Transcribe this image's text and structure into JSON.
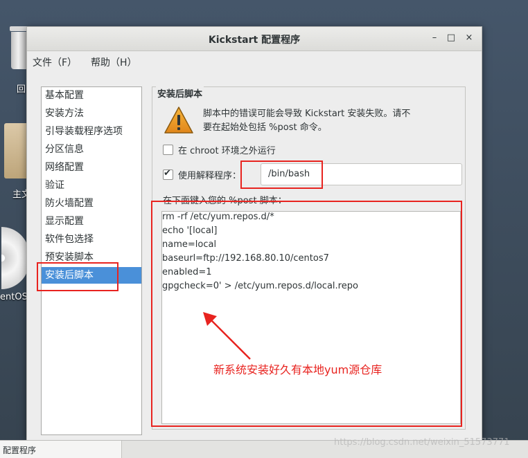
{
  "desktop": {
    "icons": [
      {
        "label": "回",
        "icon": "trash-icon"
      },
      {
        "label": "主文",
        "icon": "folder-icon"
      },
      {
        "label": "entOS",
        "icon": "disc-icon"
      }
    ]
  },
  "window": {
    "title": "Kickstart 配置程序",
    "controls": {
      "minimize": "–",
      "maximize": "□",
      "close": "×"
    }
  },
  "menubar": {
    "items": [
      "文件（F）",
      "帮助（H）"
    ]
  },
  "sidebar": {
    "items": [
      "基本配置",
      "安装方法",
      "引导装载程序选项",
      "分区信息",
      "网络配置",
      "验证",
      "防火墙配置",
      "显示配置",
      "软件包选择",
      "预安装脚本",
      "安装后脚本"
    ],
    "selected_index": 10
  },
  "panel": {
    "frame_title": "安装后脚本",
    "warning_line1": "脚本中的错误可能会导致 Kickstart 安装失败。请不",
    "warning_line2": "要在起始处包括 %post 命令。",
    "chroot_label": "在 chroot 环境之外运行",
    "chroot_checked": false,
    "interp_label": "使用解释程序：",
    "interp_checked": true,
    "interp_value": "/bin/bash",
    "editor_label": "在下面键入您的 %post 脚本：",
    "script_lines": [
      "rm -rf /etc/yum.repos.d/*",
      "echo '[local]",
      "name=local",
      "baseurl=ftp://192.168.80.10/centos7",
      "enabled=1",
      "gpgcheck=0' > /etc/yum.repos.d/local.repo"
    ]
  },
  "annotation": {
    "text": "新系统安装好久有本地yum源仓库",
    "color": "#e8231f"
  },
  "taskbar": {
    "item": "配置程序"
  },
  "watermark": "https://blog.csdn.net/weixin_51573771"
}
